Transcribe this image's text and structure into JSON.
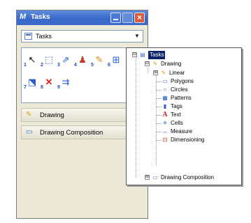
{
  "window": {
    "title": "Tasks",
    "colors": {
      "titlebar": "#3a68c8",
      "panel": "#ece9d8",
      "selection": "#0a246a"
    }
  },
  "dropdown": {
    "selected": "Tasks",
    "icon": "task-list-icon"
  },
  "toolbox": {
    "tools": [
      {
        "icon": "select-element-icon",
        "glyph": "↖",
        "number": "1"
      },
      {
        "icon": "place-fence-icon",
        "glyph": "⬚",
        "number": "2"
      },
      {
        "icon": "move-icon",
        "glyph": "⇗",
        "number": "3"
      },
      {
        "icon": "person-icon",
        "glyph": "♟",
        "number": "4"
      },
      {
        "icon": "paint-icon",
        "glyph": "✎",
        "number": "5"
      },
      {
        "icon": "measure-icon",
        "glyph": "⊞",
        "number": "6"
      },
      {
        "icon": "scale-icon",
        "glyph": "⬔",
        "number": "7"
      },
      {
        "icon": "delete-icon",
        "glyph": "✕",
        "number": "8"
      },
      {
        "icon": "drop-icon",
        "glyph": "⇉",
        "number": "9"
      }
    ]
  },
  "sections": {
    "drawing": {
      "label": "Drawing",
      "icon": "drawing-pen-icon"
    },
    "composition": {
      "label": "Drawing Composition",
      "icon": "composition-icon"
    }
  },
  "tree": {
    "root": {
      "label": "Tasks",
      "expander": "⊟"
    },
    "drawing": {
      "label": "Drawing",
      "expander": "⊟"
    },
    "linear": {
      "label": "Linear",
      "expander": "⊞"
    },
    "items": [
      {
        "label": "Polygons",
        "icon": "polygons-icon",
        "glyph": "▭"
      },
      {
        "label": "Circles",
        "icon": "circles-icon",
        "glyph": "○"
      },
      {
        "label": "Patterns",
        "icon": "patterns-icon",
        "glyph": "▦"
      },
      {
        "label": "Tags",
        "icon": "tags-icon",
        "glyph": "▮"
      },
      {
        "label": "Text",
        "icon": "text-icon",
        "glyph": "A"
      },
      {
        "label": "Cells",
        "icon": "cells-icon",
        "glyph": "✳"
      },
      {
        "label": "Measure",
        "icon": "measure-icon",
        "glyph": "↔"
      },
      {
        "label": "Dimensioning",
        "icon": "dimensioning-icon",
        "glyph": "⊡"
      }
    ],
    "composition": {
      "label": "Drawing Composition",
      "expander": "⊞"
    }
  }
}
